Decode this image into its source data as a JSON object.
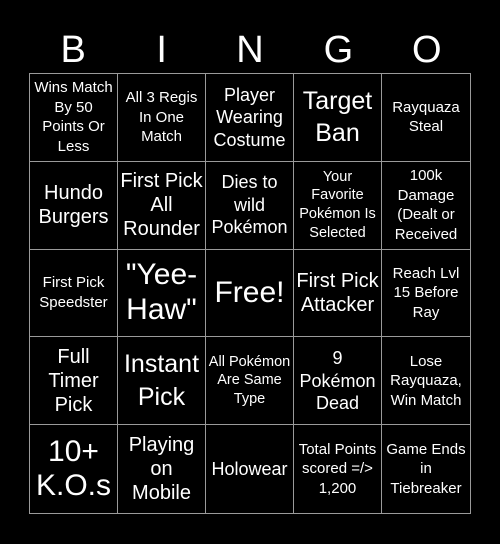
{
  "header": {
    "letters": [
      "B",
      "I",
      "N",
      "G",
      "O"
    ]
  },
  "board": {
    "cells": [
      {
        "text": "Wins Match By 50 Points Or Less",
        "free": false
      },
      {
        "text": "All 3 Regis In One Match",
        "free": false
      },
      {
        "text": "Player Wearing Costume",
        "free": false
      },
      {
        "text": "Target Ban",
        "free": false
      },
      {
        "text": "Rayquaza Steal",
        "free": false
      },
      {
        "text": "Hundo Burgers",
        "free": false
      },
      {
        "text": "First Pick All Rounder",
        "free": false
      },
      {
        "text": "Dies to wild Pokémon",
        "free": false
      },
      {
        "text": "Your Favorite Pokémon Is Selected",
        "free": false
      },
      {
        "text": "100k Damage (Dealt or Received",
        "free": false
      },
      {
        "text": "First Pick Speedster",
        "free": false
      },
      {
        "text": "\"Yee-Haw\"",
        "free": false
      },
      {
        "text": "Free!",
        "free": true
      },
      {
        "text": "First Pick Attacker",
        "free": false
      },
      {
        "text": "Reach Lvl 15 Before Ray",
        "free": false
      },
      {
        "text": "Full Timer Pick",
        "free": false
      },
      {
        "text": "Instant Pick",
        "free": false
      },
      {
        "text": "All Pokémon Are Same Type",
        "free": false
      },
      {
        "text": "9 Pokémon Dead",
        "free": false
      },
      {
        "text": "Lose Rayquaza, Win Match",
        "free": false
      },
      {
        "text": "10+ K.O.s",
        "free": false
      },
      {
        "text": "Playing on Mobile",
        "free": false
      },
      {
        "text": "Holowear",
        "free": false
      },
      {
        "text": "Total Points scored =/> 1,200",
        "free": false
      },
      {
        "text": "Game Ends in Tiebreaker",
        "free": false
      }
    ]
  },
  "colors": {
    "background": "#000000",
    "text": "#ffffff",
    "grid_lines": "#9a9a9a"
  }
}
